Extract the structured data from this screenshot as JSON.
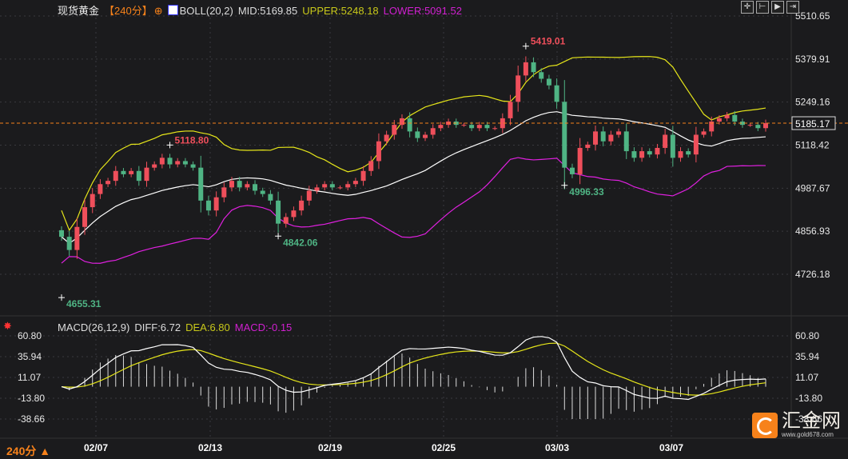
{
  "header": {
    "symbol": "现货黄金",
    "period": "【240分】",
    "boll_label": "BOLL(20,2)",
    "mid": "MID:5169.85",
    "upper": "UPPER:5248.18",
    "lower": "LOWER:5091.52"
  },
  "macd_header": {
    "label": "MACD(26,12,9)",
    "diff": "DIFF:6.72",
    "dea": "DEA:6.80",
    "macd": "MACD:-0.15"
  },
  "toolbar": [
    "crosshair-icon",
    "zoom-in-icon",
    "move-right-icon",
    "jump-end-icon"
  ],
  "timeframe": "240分 ▲",
  "logo": {
    "name": "汇金网",
    "url": "www.gold678.com"
  },
  "colors": {
    "up": "#ef4f5b",
    "down": "#4fb484",
    "mid": "#ffffff",
    "upper": "#e6e61a",
    "lower": "#e020e0",
    "price_line": "#f7821b",
    "diff": "#ffffff",
    "dea": "#e6e61a"
  },
  "chart_data": {
    "type": "candlestick",
    "price_axis": {
      "range": [
        4726.18,
        5510.65
      ],
      "ticks": [
        "5510.65",
        "5379.91",
        "5249.16",
        "5118.42",
        "4987.67",
        "4856.93",
        "4726.18"
      ]
    },
    "macd_axis": {
      "range": [
        -38.66,
        60.8
      ],
      "ticks": [
        "60.80",
        "35.94",
        "11.07",
        "-13.80",
        "-38.66"
      ]
    },
    "x_ticks": [
      "02/07",
      "02/13",
      "02/19",
      "02/25",
      "03/03",
      "03/07"
    ],
    "current_price": "5185.17",
    "annotations": [
      {
        "label": "4655.31",
        "type": "low"
      },
      {
        "label": "5118.80",
        "type": "high"
      },
      {
        "label": "4842.06",
        "type": "low"
      },
      {
        "label": "5419.01",
        "type": "high"
      },
      {
        "label": "4996.33",
        "type": "low"
      }
    ],
    "closes": [
      4840,
      4800,
      4870,
      4930,
      4970,
      5000,
      5010,
      5040,
      5030,
      5040,
      5010,
      5050,
      5060,
      5080,
      5060,
      5070,
      5060,
      5050,
      4950,
      4920,
      4960,
      4990,
      5010,
      4990,
      5000,
      4980,
      4970,
      4950,
      4880,
      4900,
      4920,
      4950,
      4980,
      4990,
      5000,
      4990,
      4990,
      5000,
      5010,
      5040,
      5070,
      5130,
      5150,
      5180,
      5200,
      5160,
      5140,
      5150,
      5170,
      5180,
      5190,
      5180,
      5180,
      5170,
      5180,
      5170,
      5170,
      5200,
      5250,
      5330,
      5370,
      5340,
      5320,
      5300,
      5250,
      5050,
      5030,
      5110,
      5120,
      5160,
      5130,
      5150,
      5160,
      5100,
      5080,
      5100,
      5090,
      5110,
      5150,
      5080,
      5100,
      5090,
      5150,
      5160,
      5190,
      5200,
      5210,
      5190,
      5180,
      5180,
      5170,
      5185.17
    ]
  }
}
